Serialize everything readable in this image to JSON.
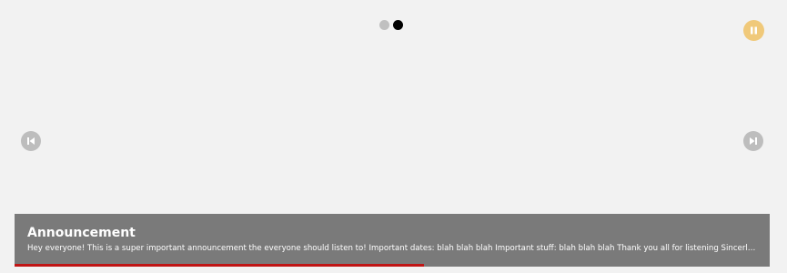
{
  "carousel": {
    "slide_count": 2,
    "active_slide": 2,
    "progress": 0.542,
    "colors": {
      "background": "#f2f2f2",
      "pause_button": "#f0c97a",
      "nav_button": "#bdbdbd",
      "caption_background": "#7a7a7a",
      "progress_bar": "#c01515",
      "dot_inactive": "#c0c0c0",
      "dot_active": "#000000"
    },
    "icons": {
      "pause": "pause-icon",
      "prev": "skip-previous-icon",
      "next": "skip-next-icon"
    }
  },
  "caption": {
    "title": "Announcement",
    "text": "Hey everyone! This is a super important announcement the everyone should listen to! Important dates: blah blah blah Important stuff: blah blah blah Thank you all for listening Sincerly, Build..."
  }
}
